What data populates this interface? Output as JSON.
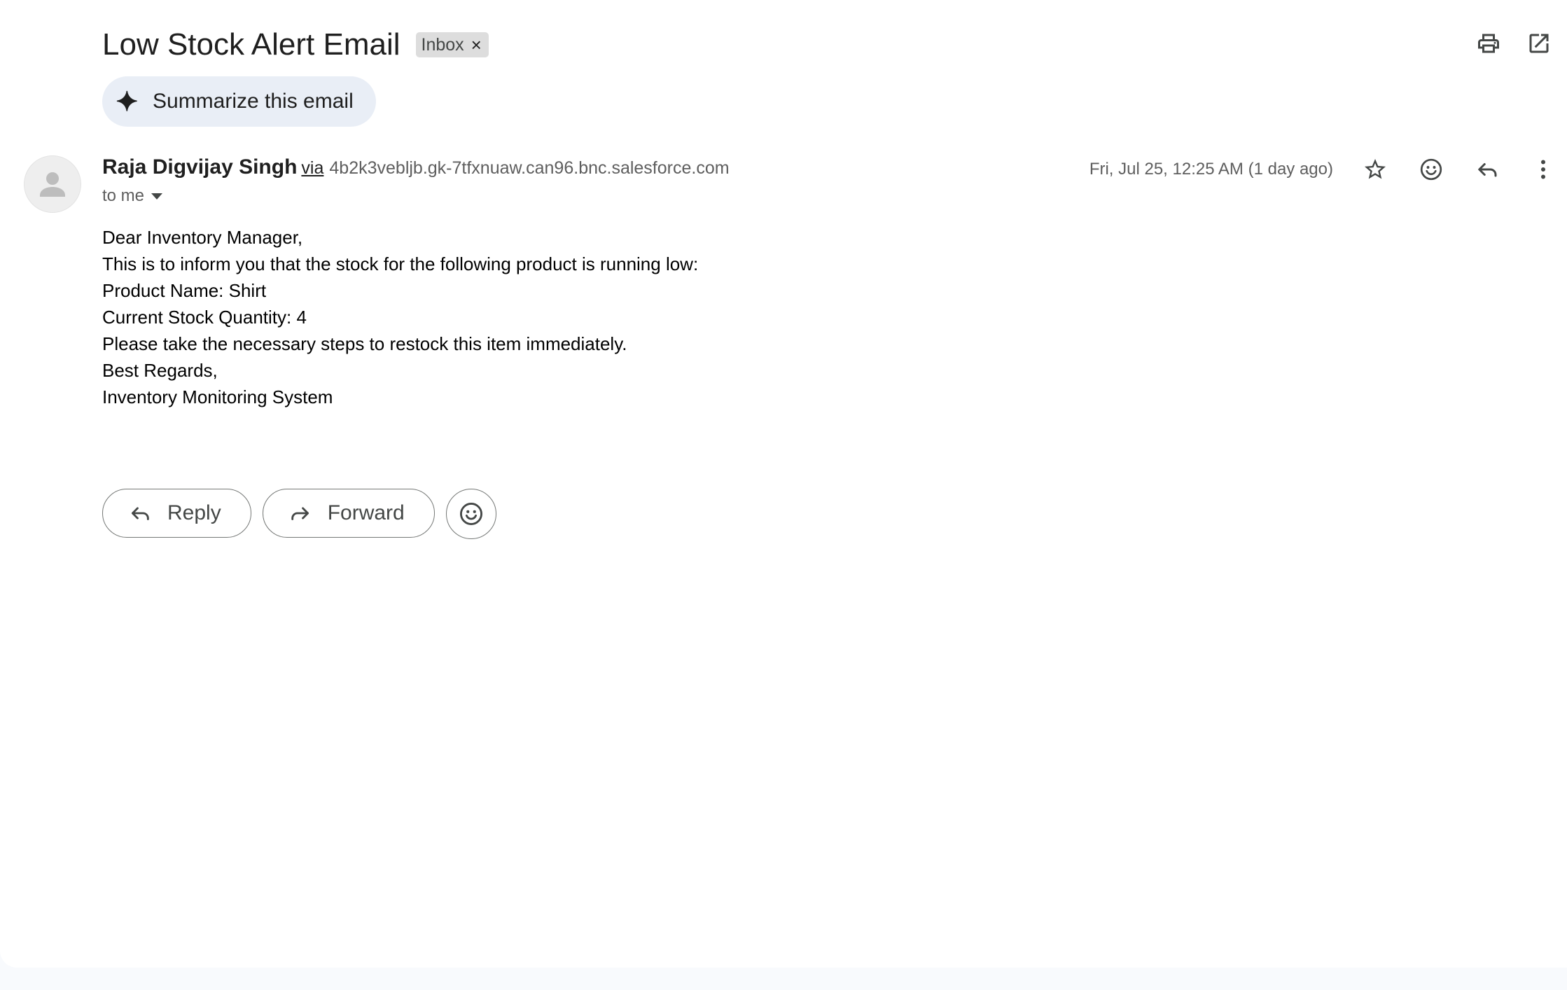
{
  "subject": "Low Stock Alert Email",
  "label_chip": {
    "text": "Inbox",
    "remove": "×"
  },
  "top_actions": {
    "print_icon": "printer-icon",
    "open_new_window_icon": "open-in-new-icon"
  },
  "summarize": {
    "label": "Summarize this email",
    "icon": "sparkle-icon"
  },
  "sender": {
    "name": "Raja Digvijay Singh",
    "via": "via",
    "address": "4b2k3vebljb.gk-7tfxnuaw.can96.bnc.salesforce.com",
    "to": "to me"
  },
  "meta": {
    "date": "Fri, Jul 25, 12:25 AM (1 day ago)",
    "icons": [
      "star-icon",
      "emoji-icon",
      "reply-icon",
      "more-vert-icon"
    ]
  },
  "body": {
    "lines": [
      "Dear Inventory Manager,",
      "This is to inform you that the stock for the following product is running low:",
      "Product Name: Shirt",
      "Current Stock Quantity: 4",
      "Please take the necessary steps to restock this item immediately.",
      "Best Regards,",
      "Inventory Monitoring System"
    ]
  },
  "bottom_actions": {
    "reply_label": "Reply",
    "forward_label": "Forward",
    "emoji_icon": "emoji-icon"
  },
  "colors": {
    "accent_chip_bg": "#dddddd",
    "summarize_bg": "#e9eef6",
    "text_primary": "#1f1f1f",
    "text_secondary": "#5e5e5e"
  }
}
